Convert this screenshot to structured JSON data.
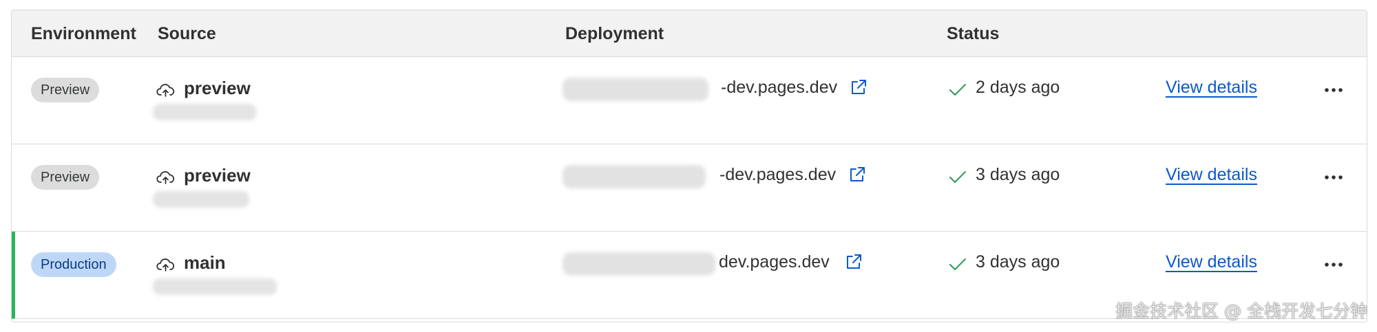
{
  "table": {
    "columns": [
      "Environment",
      "Source",
      "Deployment",
      "Status"
    ],
    "rows": [
      {
        "environment": "Preview",
        "source_icon": "cloud-upload-icon",
        "source": "preview",
        "deployment_suffix": "-dev.pages.dev",
        "status_icon": "check-icon",
        "status": "2 days ago",
        "details_label": "View details"
      },
      {
        "environment": "Preview",
        "source_icon": "cloud-upload-icon",
        "source": "preview",
        "deployment_suffix": "-dev.pages.dev",
        "status_icon": "check-icon",
        "status": "3 days ago",
        "details_label": "View details"
      },
      {
        "environment": "Production",
        "source_icon": "cloud-upload-icon",
        "source": "main",
        "deployment_suffix": "dev.pages.dev",
        "status_icon": "check-icon",
        "status": "3 days ago",
        "details_label": "View details"
      }
    ]
  },
  "colors": {
    "link": "#0b59c9",
    "success": "#2db35d",
    "production_badge": "#bfd7f7",
    "preview_badge": "#dcdcdc"
  },
  "watermark": "掘金技术社区 @ 全栈开发七分钟"
}
